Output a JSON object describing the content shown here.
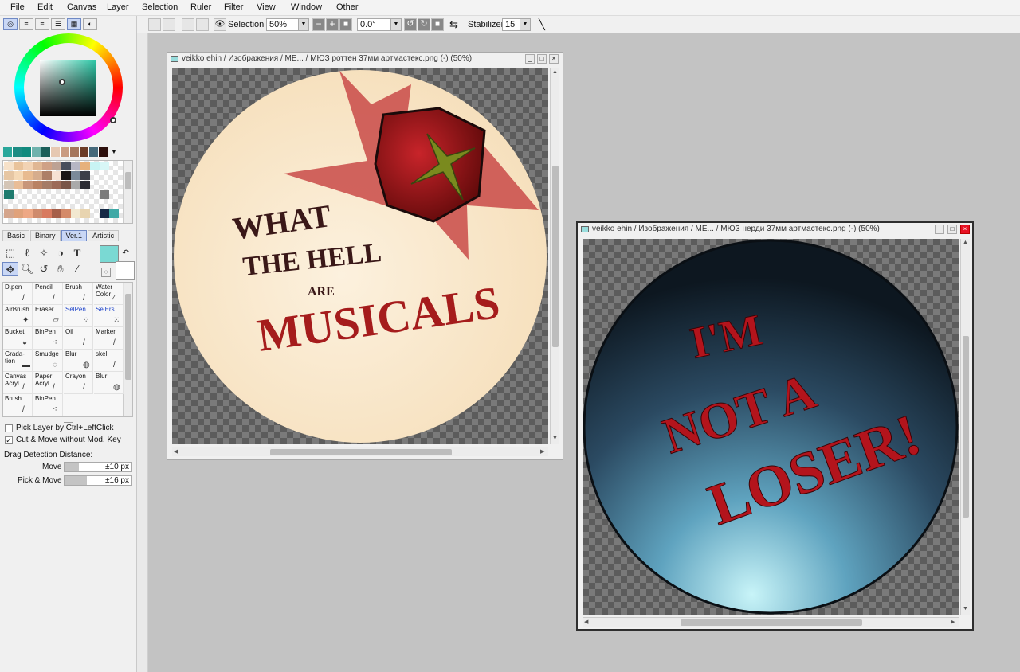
{
  "menu": [
    "File",
    "Edit",
    "Canvas",
    "Layer",
    "Selection",
    "Ruler",
    "Filter",
    "View",
    "Window",
    "Other"
  ],
  "toolbar": {
    "selection_label": "Selection",
    "zoom": "50%",
    "rotation": "0.0°",
    "stabilizer_label": "Stabilizer",
    "stabilizer_value": "15"
  },
  "color": {
    "foreground": "#7ad9d3",
    "background": "#ffffff",
    "current_hue": "#2cc7a6"
  },
  "panel_tabs": [
    "Basic",
    "Binary",
    "Ver.1",
    "Artistic"
  ],
  "selected_tab": "Ver.1",
  "brushes": [
    {
      "label": "D.pen",
      "icon": "pen-icon"
    },
    {
      "label": "Pencil",
      "icon": "pencil-icon"
    },
    {
      "label": "Brush",
      "icon": "brush-icon"
    },
    {
      "label": "Water Color",
      "icon": "watercolor-icon"
    },
    {
      "label": "AirBrush",
      "icon": "airbrush-icon"
    },
    {
      "label": "Eraser",
      "icon": "eraser-icon"
    },
    {
      "label": "SelPen",
      "icon": "selpen-icon"
    },
    {
      "label": "SelErs",
      "icon": "selers-icon"
    },
    {
      "label": "Bucket",
      "icon": "bucket-icon"
    },
    {
      "label": "BinPen",
      "icon": "binpen-icon"
    },
    {
      "label": "Oil",
      "icon": "oil-icon"
    },
    {
      "label": "Marker",
      "icon": "marker-icon"
    },
    {
      "label": "Grada-tion",
      "icon": "gradation-icon"
    },
    {
      "label": "Smudge",
      "icon": "smudge-icon"
    },
    {
      "label": "Blur",
      "icon": "blur-icon"
    },
    {
      "label": "skel",
      "icon": "skel-icon"
    },
    {
      "label": "Canvas Acryl",
      "icon": "canvas-acryl-icon"
    },
    {
      "label": "Paper Acryl",
      "icon": "paper-acryl-icon"
    },
    {
      "label": "Crayon",
      "icon": "crayon-icon"
    },
    {
      "label": "Blur",
      "icon": "blur-icon"
    },
    {
      "label": "Brush",
      "icon": "brush-icon"
    },
    {
      "label": "BinPen",
      "icon": "binpen-icon"
    }
  ],
  "options": {
    "pick_layer": "Pick Layer by Ctrl+LeftClick",
    "pick_layer_checked": false,
    "cut_move": "Cut & Move without Mod. Key",
    "cut_move_checked": true,
    "drag_detection": "Drag Detection Distance:",
    "move_label": "Move",
    "move_value": "±10 px",
    "pick_move_label": "Pick & Move",
    "pick_move_value": "±16 px"
  },
  "windows": [
    {
      "title": "veikko ehin / Изображения / МЕ... / МЮЗ роттен 37мм артмастекс.png (-) (50%)",
      "artwork": [
        "WHAT",
        "THE HELL",
        "ARE",
        "MUSICALS"
      ]
    },
    {
      "title": "veikko ehin / Изображения / МЕ...  / МЮЗ нерди 37мм артмастекс.png (-) (50%)",
      "artwork": [
        "I'M",
        "NOT A",
        "LOSER!"
      ]
    }
  ]
}
